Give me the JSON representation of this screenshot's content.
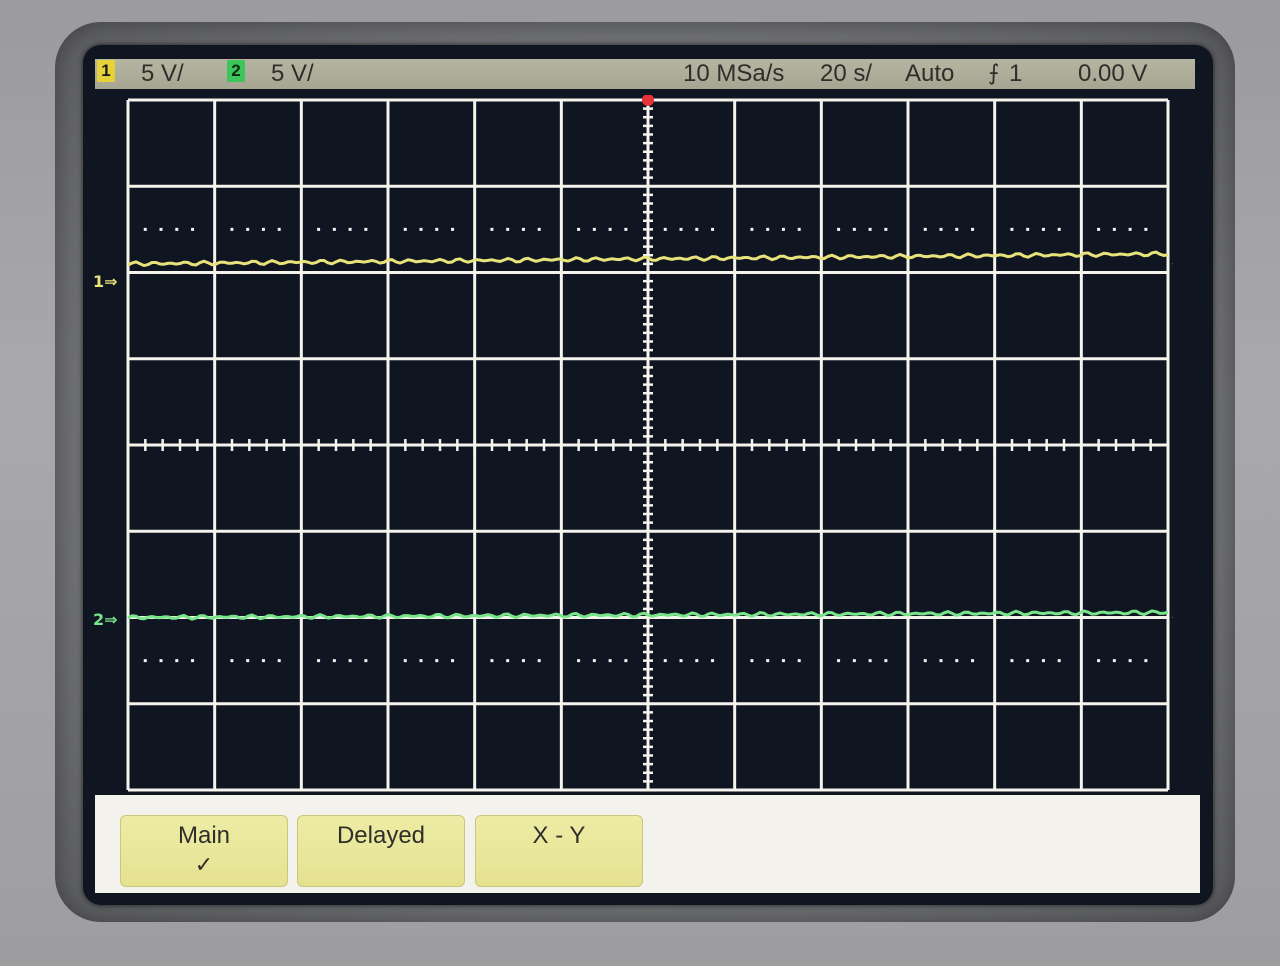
{
  "status": {
    "ch1_badge": "1",
    "ch1_scale": "5 V/",
    "ch2_badge": "2",
    "ch2_scale": "5 V/",
    "sample_rate": "10 MSa/s",
    "timebase": "20 s/",
    "trigger_mode": "Auto",
    "trigger_icon": "rising-edge-trigger-icon",
    "trigger_source": "1",
    "trigger_level": "0.00 V"
  },
  "channels": [
    {
      "badge": "1",
      "color": "#e8e27a",
      "ground_level_divisions": 2.1
    },
    {
      "badge": "2",
      "color": "#79e58a",
      "ground_level_divisions": -2.0
    }
  ],
  "grid": {
    "horizontal_divisions": 12,
    "vertical_divisions": 8,
    "color": "#f4f4ec"
  },
  "trigger_marker_color": "#e8333a",
  "softkeys": [
    {
      "label": "Main",
      "checked": "✓"
    },
    {
      "label": "Delayed",
      "checked": ""
    },
    {
      "label": "X - Y",
      "checked": ""
    }
  ],
  "colors": {
    "screen_background": "#101522",
    "status_bar": "#b0af9b",
    "softkey": "#e8e699"
  }
}
